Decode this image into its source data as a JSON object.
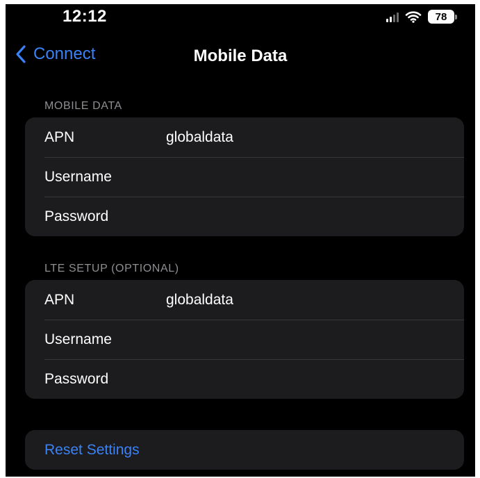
{
  "status_bar": {
    "time": "12:12",
    "battery_percent": "78",
    "icons": [
      "cellular-signal-icon",
      "wifi-icon",
      "battery-icon"
    ]
  },
  "nav": {
    "back_label": "Connect",
    "title": "Mobile Data"
  },
  "mobile_data": {
    "header": "MOBILE DATA",
    "rows": [
      {
        "label": "APN",
        "value": "globaldata"
      },
      {
        "label": "Username",
        "value": ""
      },
      {
        "label": "Password",
        "value": ""
      }
    ]
  },
  "lte_setup": {
    "header": "LTE SETUP (OPTIONAL)",
    "rows": [
      {
        "label": "APN",
        "value": "globaldata"
      },
      {
        "label": "Username",
        "value": ""
      },
      {
        "label": "Password",
        "value": ""
      }
    ]
  },
  "reset": {
    "label": "Reset Settings"
  },
  "colors": {
    "background": "#000000",
    "cell_background": "#1c1c1e",
    "accent": "#3b82f6",
    "secondary_text": "#8e8e93"
  }
}
